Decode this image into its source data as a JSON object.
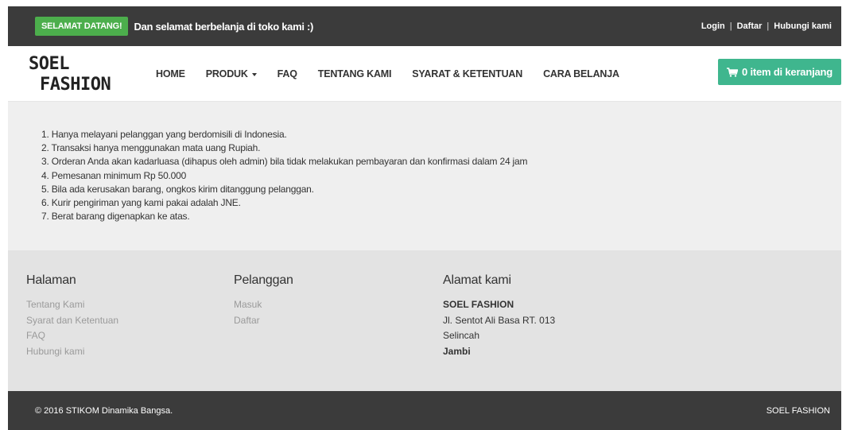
{
  "topbar": {
    "badge": "SELAMAT DATANG!",
    "welcome": "Dan selamat berbelanja di toko kami :)",
    "links": [
      "Login",
      "Daftar",
      "Hubungi kami"
    ],
    "separator": "|"
  },
  "header": {
    "logo_line1": "SOEL",
    "logo_line2": "FASHION",
    "nav": [
      "HOME",
      "PRODUK",
      "FAQ",
      "TENTANG KAMI",
      "SYARAT & KETENTUAN",
      "CARA BELANJA"
    ],
    "cart_label": "0 item di keranjang",
    "cart_icon": "shopping-cart-icon"
  },
  "content": {
    "rules": [
      "1. Hanya melayani pelanggan yang berdomisili di Indonesia.",
      "2. Transaksi hanya menggunakan mata uang Rupiah.",
      "3. Orderan Anda akan kadarluasa (dihapus oleh admin) bila tidak melakukan pembayaran dan konfirmasi dalam 24 jam",
      "4. Pemesanan minimum Rp 50.000",
      "5. Bila ada kerusakan barang, ongkos kirim ditanggung pelanggan.",
      "6. Kurir pengiriman yang kami pakai adalah JNE.",
      "7. Berat barang digenapkan ke atas."
    ]
  },
  "footer": {
    "halaman": {
      "title": "Halaman",
      "links": [
        "Tentang Kami",
        "Syarat dan Ketentuan",
        "FAQ",
        "Hubungi kami"
      ]
    },
    "pelanggan": {
      "title": "Pelanggan",
      "links": [
        "Masuk",
        "Daftar"
      ]
    },
    "alamat": {
      "title": "Alamat kami",
      "name": "SOEL FASHION",
      "street": "Jl. Sentot Ali Basa RT. 013",
      "area": "Selincah",
      "city": "Jambi"
    }
  },
  "bottom": {
    "copyright": "© 2016 STIKOM Dinamika Bangsa.",
    "brand": "SOEL FASHION"
  },
  "colors": {
    "dark_bar": "#3b3b3b",
    "badge_green": "#4cae4c",
    "cart_green": "#3fb68e",
    "content_bg": "#efefef",
    "footer_bg": "#e3e3e3"
  }
}
